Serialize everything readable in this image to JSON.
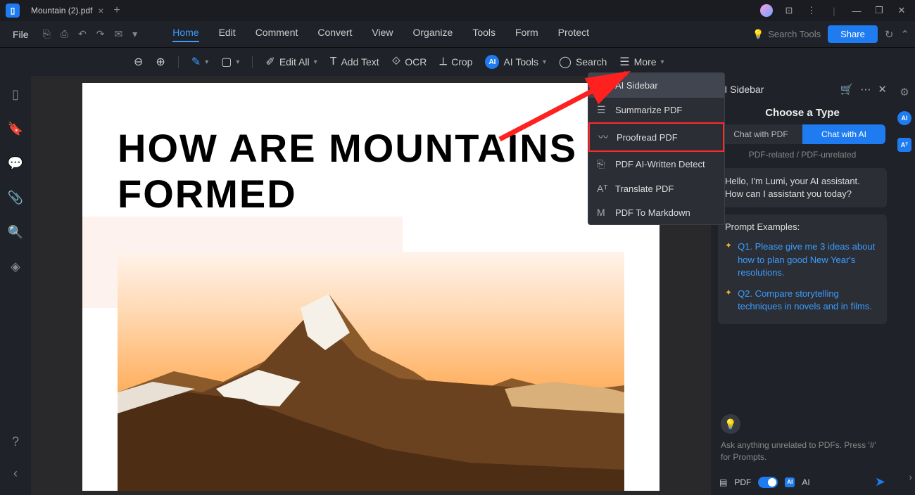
{
  "tab": {
    "title": "Mountain (2).pdf"
  },
  "menubar": {
    "file": "File",
    "items": [
      "Home",
      "Edit",
      "Comment",
      "Convert",
      "View",
      "Organize",
      "Tools",
      "Form",
      "Protect"
    ],
    "active": 0,
    "search_placeholder": "Search Tools",
    "share": "Share"
  },
  "toolbar": {
    "edit_all": "Edit All",
    "add_text": "Add Text",
    "ocr": "OCR",
    "crop": "Crop",
    "ai_tools": "AI Tools",
    "search": "Search",
    "more": "More"
  },
  "dropdown": {
    "items": [
      {
        "icon": "✓",
        "label": "AI Sidebar",
        "hovered": true
      },
      {
        "icon": "☰",
        "label": "Summarize PDF"
      },
      {
        "icon": "〰",
        "label": "Proofread PDF",
        "boxed": true
      },
      {
        "icon": "⎘",
        "label": "PDF AI-Written Detect"
      },
      {
        "icon": "A⁺",
        "label": "Translate PDF"
      },
      {
        "icon": "M",
        "label": "PDF To Markdown"
      }
    ]
  },
  "document": {
    "heading": "HOW ARE MOUNTAINS FORMED"
  },
  "ai_panel": {
    "title": "AI Sidebar",
    "choose": "Choose a Type",
    "tab_pdf": "Chat with PDF",
    "tab_ai": "Chat with AI",
    "related": "PDF-related / PDF-unrelated",
    "message": "Hello, I'm Lumi, your AI assistant. How can I assistant you today?",
    "prompt_title": "Prompt Examples:",
    "q1": "Q1. Please give me 3 ideas about how to plan good New Year's resolutions.",
    "q2": "Q2. Compare storytelling techniques in novels and in films.",
    "ask": "Ask anything unrelated to PDFs. Press '#' for Prompts.",
    "pdf_label": "PDF",
    "ai_label": "AI"
  }
}
